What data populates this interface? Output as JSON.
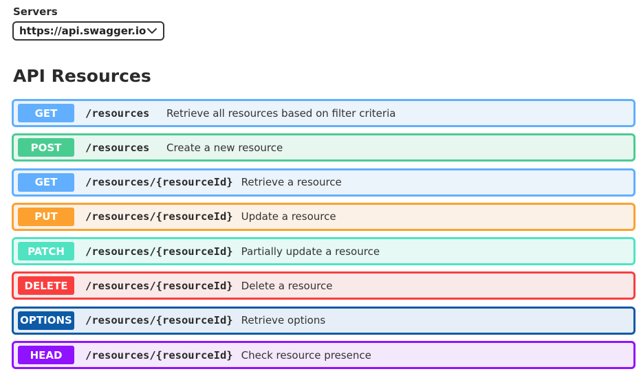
{
  "servers": {
    "label": "Servers",
    "selected": "https://api.swagger.io"
  },
  "section": {
    "title": "API Resources"
  },
  "operations": [
    {
      "method": "GET",
      "path": "/resources",
      "description": "Retrieve all resources based on filter criteria",
      "color": "#61affe",
      "bg": "#ebf3fb"
    },
    {
      "method": "POST",
      "path": "/resources",
      "description": "Create a new resource",
      "color": "#49cc90",
      "bg": "#e8f6f0"
    },
    {
      "method": "GET",
      "path": "/resources/{resourceId}",
      "description": "Retrieve a resource",
      "color": "#61affe",
      "bg": "#ebf3fb"
    },
    {
      "method": "PUT",
      "path": "/resources/{resourceId}",
      "description": "Update a resource",
      "color": "#fca130",
      "bg": "#fbf1e6"
    },
    {
      "method": "PATCH",
      "path": "/resources/{resourceId}",
      "description": "Partially update a resource",
      "color": "#50e3c2",
      "bg": "#e6f9f4"
    },
    {
      "method": "DELETE",
      "path": "/resources/{resourceId}",
      "description": "Delete a resource",
      "color": "#f93e3e",
      "bg": "#fae9e9"
    },
    {
      "method": "OPTIONS",
      "path": "/resources/{resourceId}",
      "description": "Retrieve options",
      "color": "#0d5aa7",
      "bg": "#e6eef7"
    },
    {
      "method": "HEAD",
      "path": "/resources/{resourceId}",
      "description": "Check resource presence",
      "color": "#9012fe",
      "bg": "#f3e8fc"
    }
  ]
}
